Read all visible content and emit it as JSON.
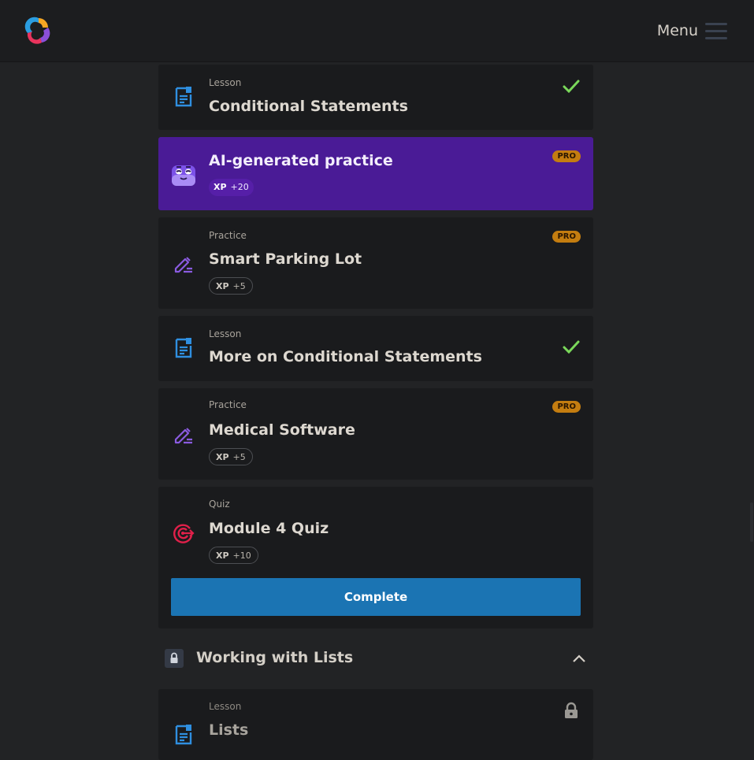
{
  "header": {
    "logo": "sololearn-logo-icon",
    "menu_label": "Menu"
  },
  "items": [
    {
      "kind": "Lesson",
      "title": "Conditional Statements",
      "status": "completed",
      "icon": "lesson-icon"
    },
    {
      "title": "AI-generated practice",
      "badge": "PRO",
      "xp_label": "XP",
      "xp_value": "+20",
      "icon": "ai-mascot-icon"
    },
    {
      "kind": "Practice",
      "title": "Smart Parking Lot",
      "badge": "PRO",
      "xp_label": "XP",
      "xp_value": "+5",
      "icon": "practice-pencil-icon"
    },
    {
      "kind": "Lesson",
      "title": "More on Conditional Statements",
      "status": "completed",
      "icon": "lesson-icon"
    },
    {
      "kind": "Practice",
      "title": "Medical Software",
      "badge": "PRO",
      "xp_label": "XP",
      "xp_value": "+5",
      "icon": "practice-pencil-icon"
    },
    {
      "kind": "Quiz",
      "title": "Module 4 Quiz",
      "xp_label": "XP",
      "xp_value": "+10",
      "icon": "quiz-target-icon",
      "button_label": "Complete"
    }
  ],
  "next_section": {
    "title": "Working with Lists",
    "locked": true,
    "expanded": true,
    "items": [
      {
        "kind": "Lesson",
        "title": "Lists",
        "locked": true,
        "icon": "lesson-icon"
      }
    ]
  },
  "colors": {
    "accent_blue": "#1b74b3",
    "ai_purple": "#4a1b96",
    "pro_badge": "#c47d10",
    "check_green": "#7ad85a",
    "practice_purple": "#8a5be0",
    "quiz_red": "#e0204a",
    "lesson_blue": "#2f8fe0"
  }
}
